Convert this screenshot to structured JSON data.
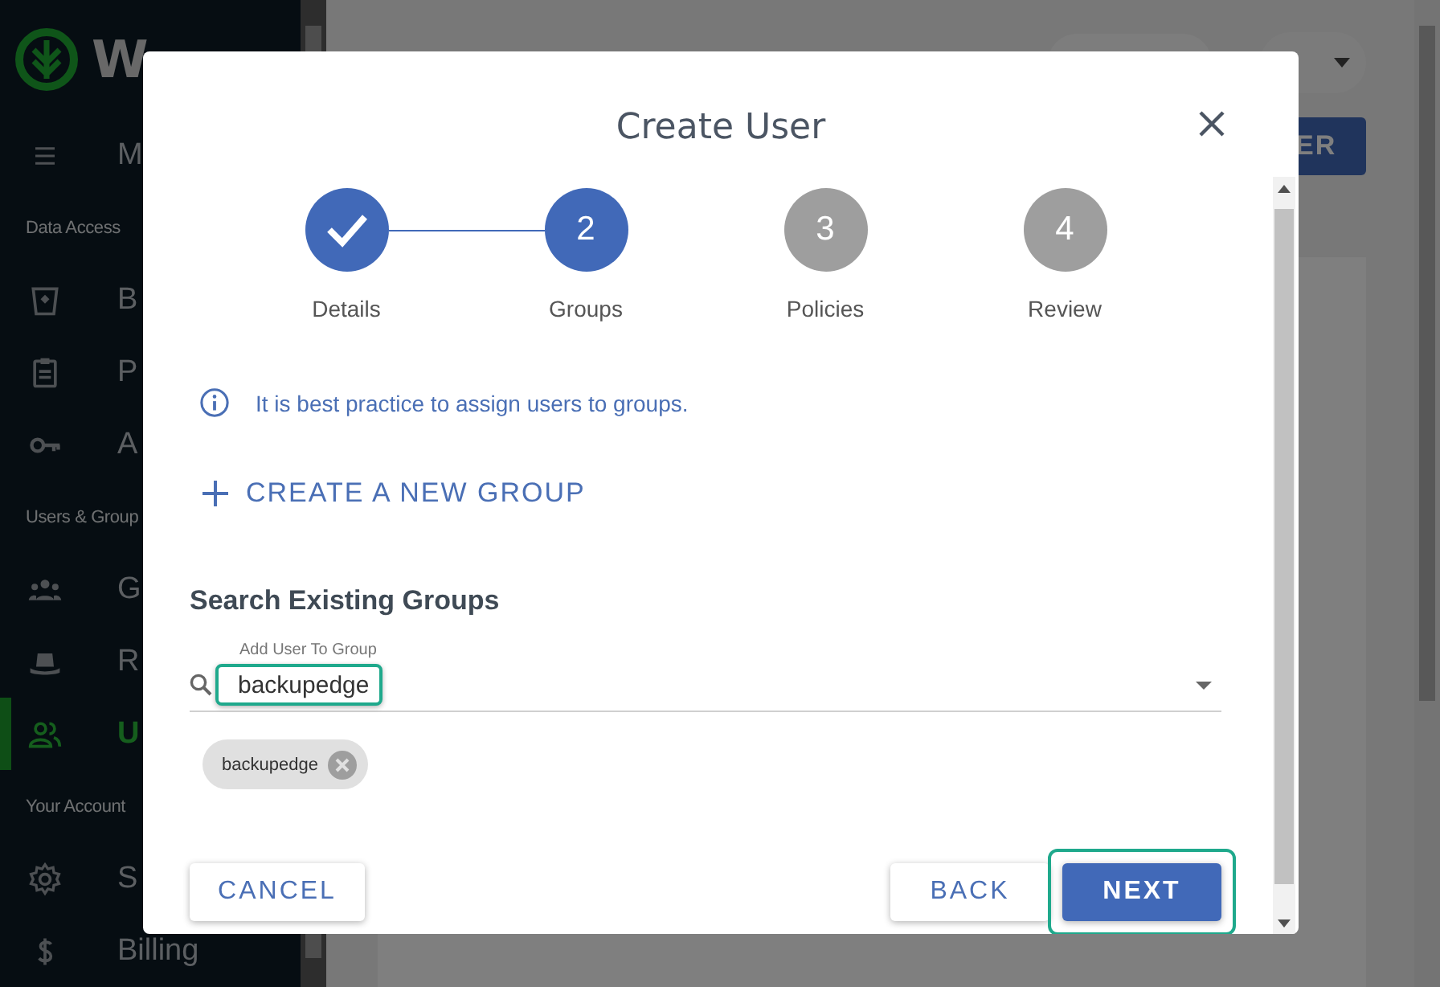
{
  "sidebar": {
    "logo_text": "W",
    "menu_label": "M",
    "sections": [
      {
        "header": "Data Access",
        "items": [
          {
            "label": "B",
            "selected": false
          },
          {
            "label": "P",
            "selected": false
          },
          {
            "label": "A",
            "selected": false
          }
        ]
      },
      {
        "header": "Users & Group",
        "items": [
          {
            "label": "G",
            "selected": false
          },
          {
            "label": "R",
            "selected": false
          },
          {
            "label": "U",
            "selected": true
          }
        ]
      },
      {
        "header": "Your Account",
        "items": [
          {
            "label": "S",
            "selected": false
          },
          {
            "label": "Billing",
            "selected": false
          }
        ]
      }
    ]
  },
  "main": {
    "action_button": "ER"
  },
  "dialog": {
    "title": "Create User",
    "steps": [
      {
        "label": "Details",
        "done": true
      },
      {
        "number": "2",
        "label": "Groups",
        "done": false
      },
      {
        "number": "3",
        "label": "Policies",
        "done": false
      },
      {
        "number": "4",
        "label": "Review",
        "done": false
      }
    ],
    "info": "It is best practice to assign users to groups.",
    "create_group": "CREATE A NEW GROUP",
    "search_heading": "Search Existing Groups",
    "field": {
      "label": "Add User To Group",
      "value": "backupedge",
      "highlighted": true
    },
    "chips": [
      {
        "label": "backupedge"
      }
    ],
    "buttons": [
      {
        "label": "CANCEL",
        "kind": "text",
        "highlighted": false
      },
      {
        "label": "BACK",
        "kind": "text",
        "highlighted": false
      },
      {
        "label": "NEXT",
        "kind": "primary",
        "highlighted": true
      }
    ]
  }
}
